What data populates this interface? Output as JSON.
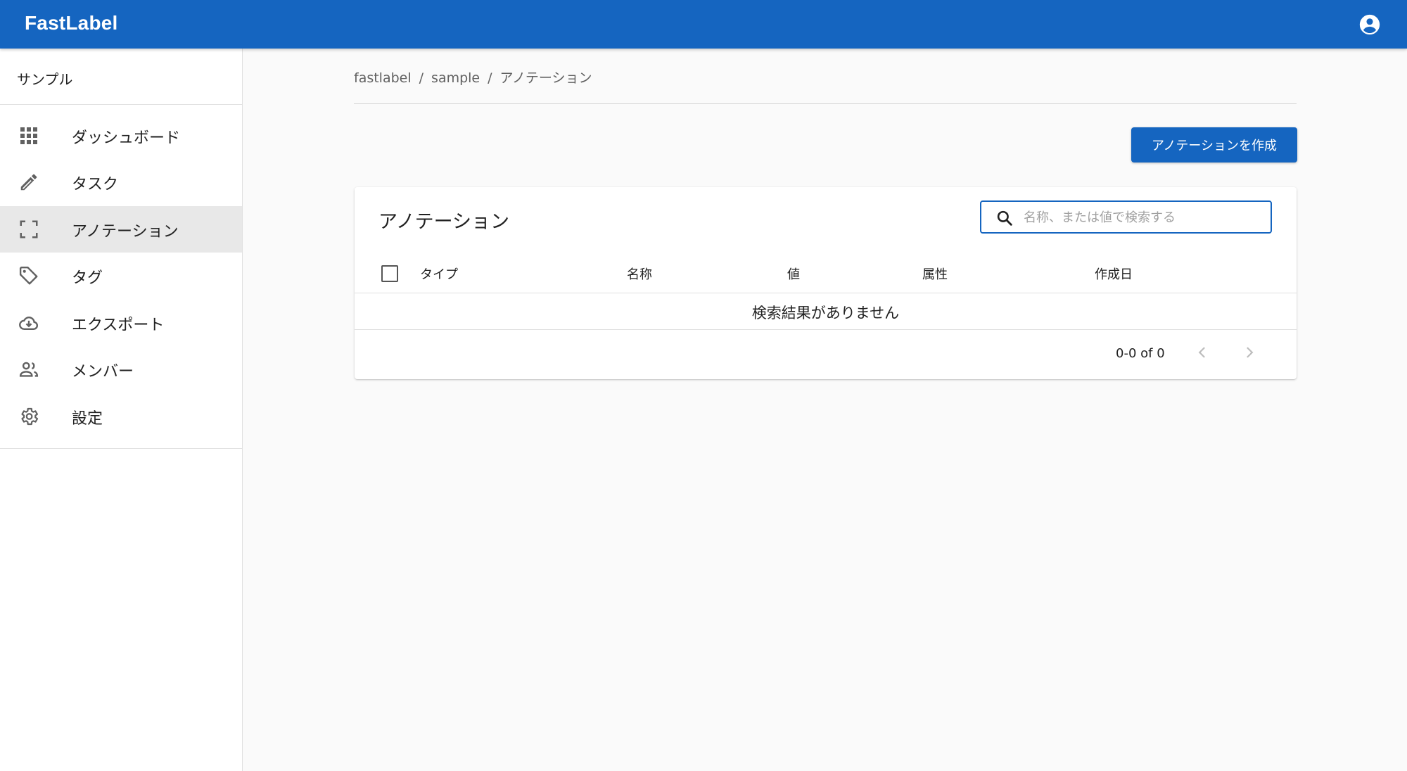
{
  "app": {
    "brand": "FastLabel",
    "account_icon": "account-circle-icon"
  },
  "sidebar": {
    "project": "サンプル",
    "items": [
      {
        "label": "ダッシュボード",
        "icon": "grid-icon"
      },
      {
        "label": "タスク",
        "icon": "pencil-icon"
      },
      {
        "label": "アノテーション",
        "icon": "crop-frame-icon"
      },
      {
        "label": "タグ",
        "icon": "tag-icon"
      },
      {
        "label": "エクスポート",
        "icon": "cloud-download-icon"
      },
      {
        "label": "メンバー",
        "icon": "people-icon"
      },
      {
        "label": "設定",
        "icon": "gear-icon"
      }
    ],
    "active_index": 2
  },
  "breadcrumb": {
    "items": [
      "fastlabel",
      "sample",
      "アノテーション"
    ],
    "separator": "/"
  },
  "toolbar": {
    "create_label": "アノテーションを作成"
  },
  "card": {
    "title": "アノテーション",
    "search": {
      "placeholder": "名称、または値で検索する",
      "value": ""
    },
    "columns": [
      "タイプ",
      "名称",
      "値",
      "属性",
      "作成日"
    ],
    "empty_message": "検索結果がありません",
    "pagination": {
      "range_text": "0-0 of 0"
    }
  },
  "colors": {
    "primary": "#1565c0",
    "active_nav_bg": "#e8e8e8",
    "page_bg": "#fafafa"
  }
}
